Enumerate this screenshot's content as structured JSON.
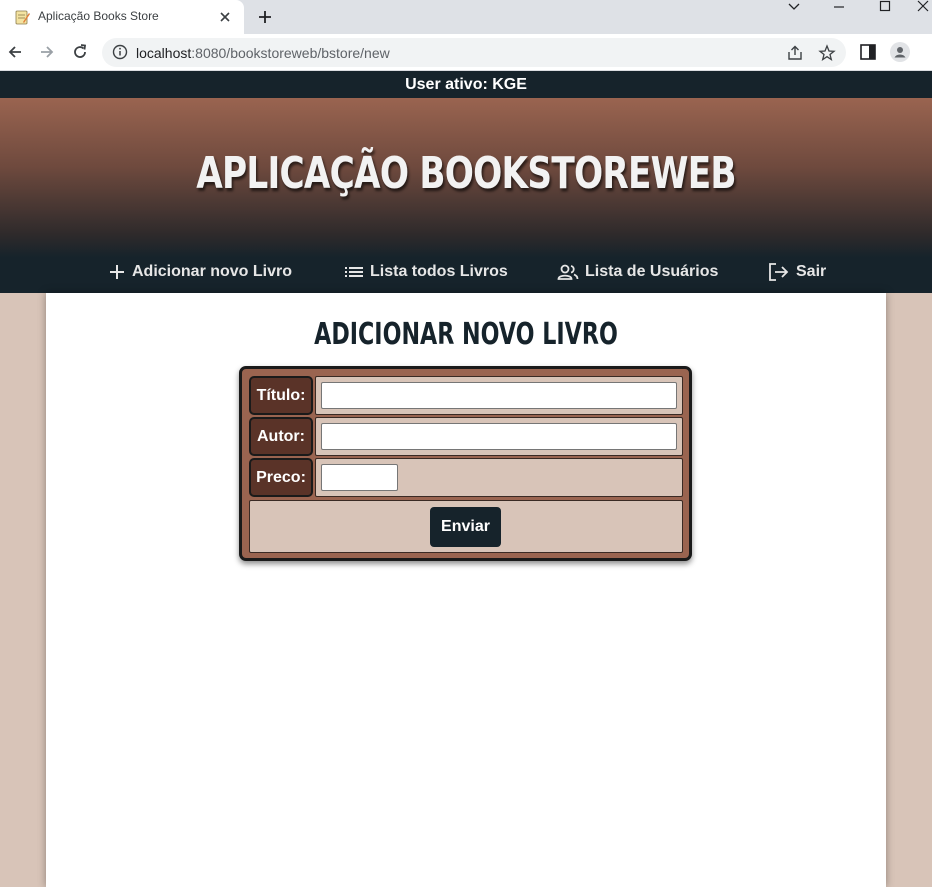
{
  "browser": {
    "tab_title": "Aplicação Books Store",
    "url_host": "localhost",
    "url_rest": ":8080/bookstoreweb/bstore/new"
  },
  "page": {
    "user_bar": "User ativo: KGE",
    "site_title": "APLICAÇÃO BOOKSTOREWEB",
    "nav": {
      "add_book": "Adicionar novo Livro",
      "list_books": "Lista todos Livros",
      "list_users": "Lista de Usuários",
      "logout": "Sair"
    },
    "form": {
      "title": "ADICIONAR NOVO LIVRO",
      "titulo_label": "Título:",
      "titulo_value": "",
      "autor_label": "Autor:",
      "autor_value": "",
      "preco_label": "Preco:",
      "preco_value": "",
      "submit_label": "Enviar"
    }
  },
  "colors": {
    "dark": "#16232b",
    "brown": "#9a6450",
    "dark_brown": "#5a3328",
    "beige": "#d8c4b8"
  }
}
